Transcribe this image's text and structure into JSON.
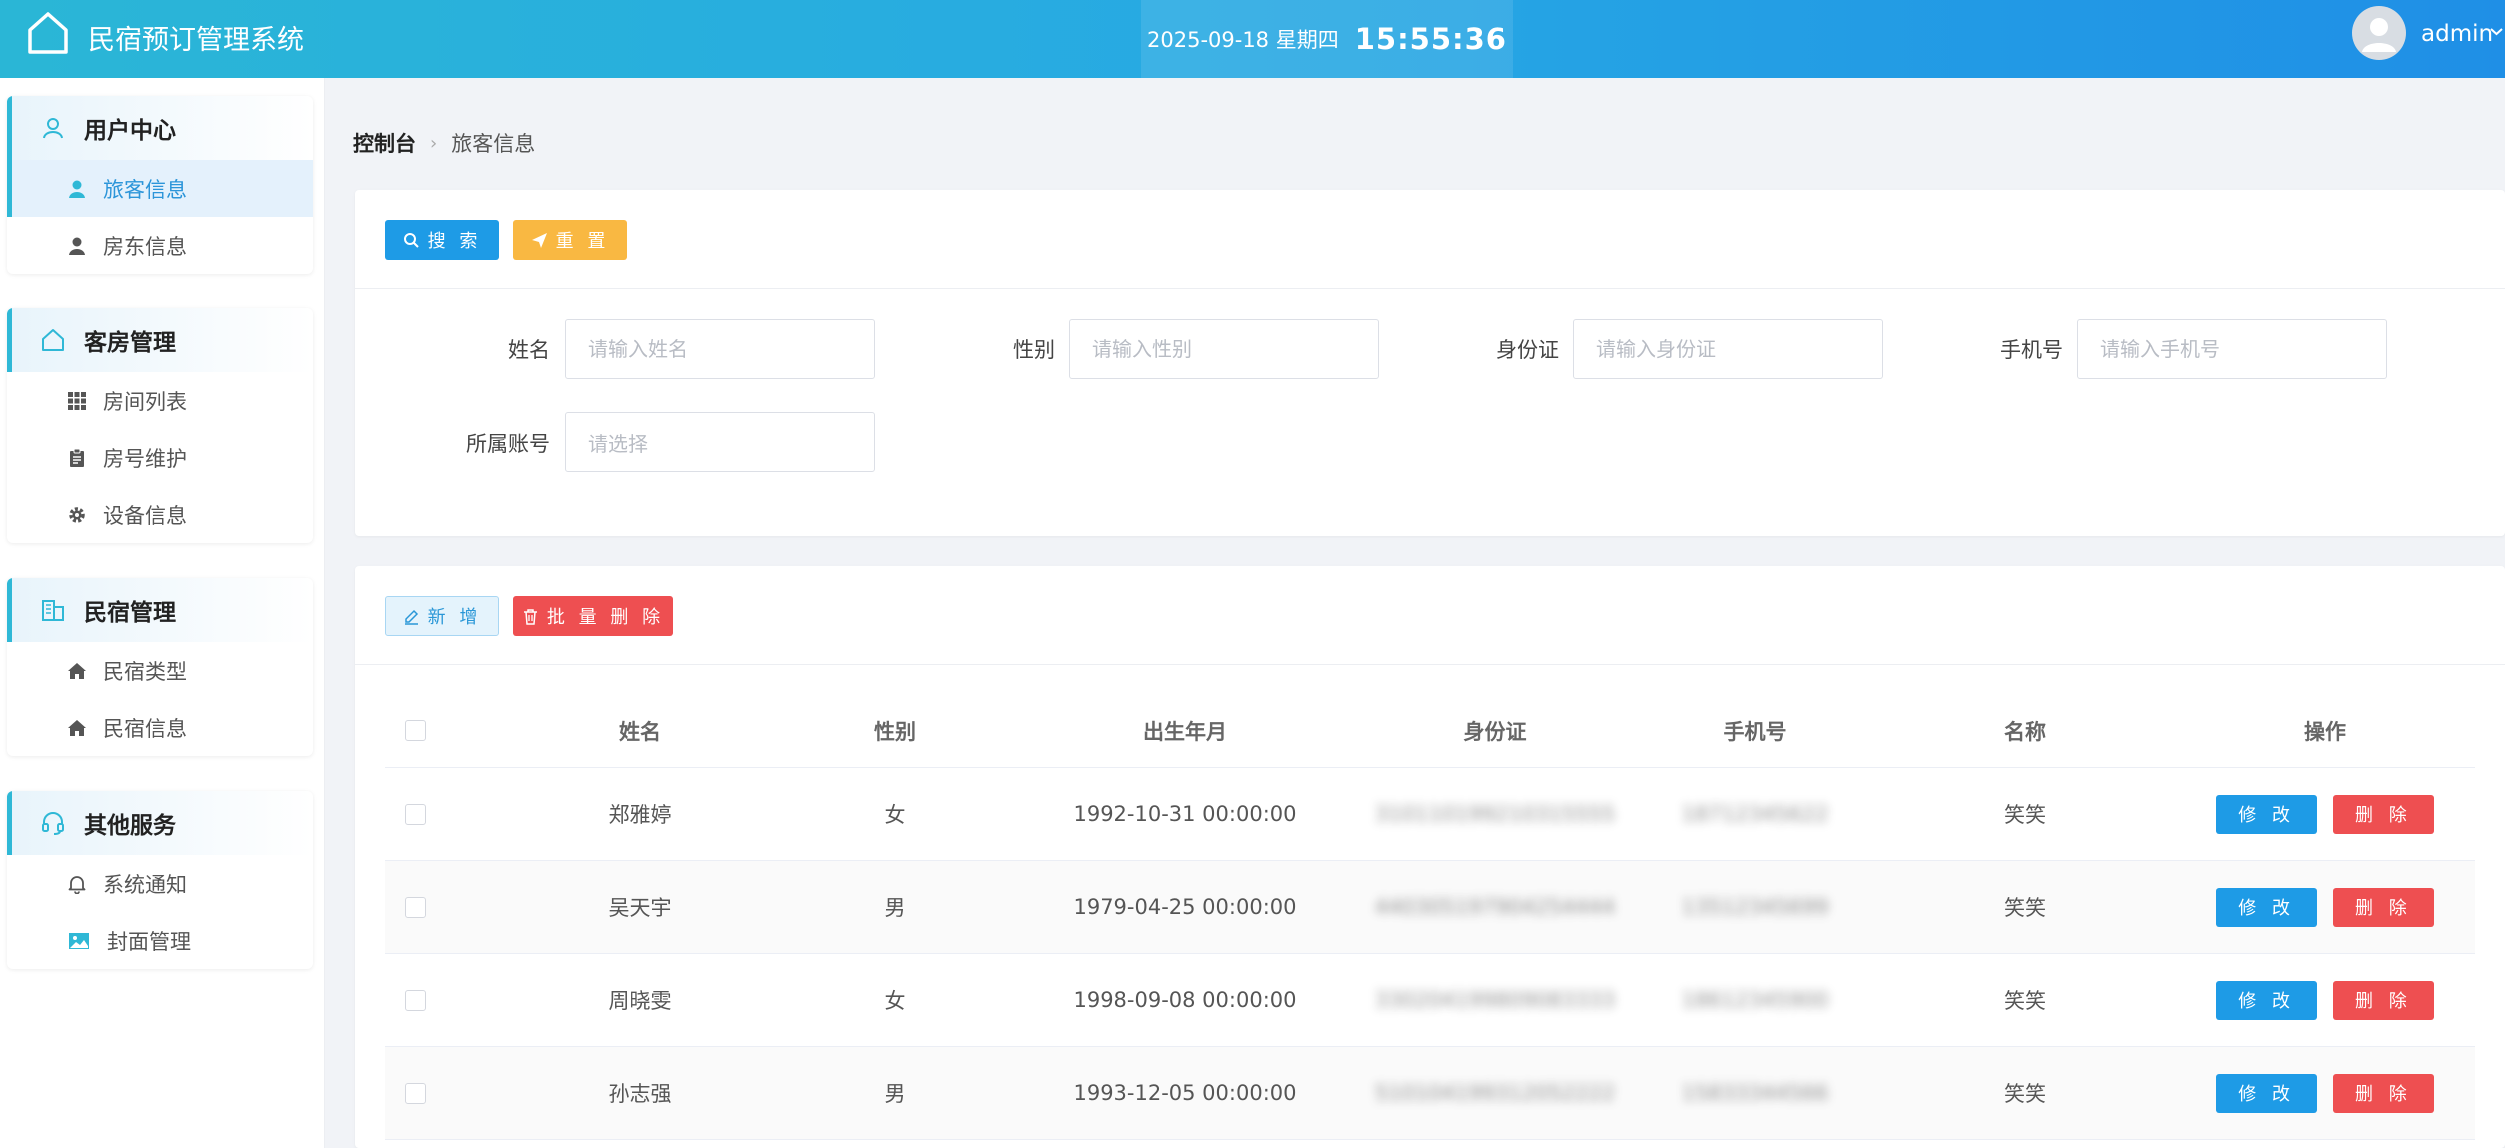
{
  "app": {
    "title": "民宿预订管理系统"
  },
  "clock": {
    "date": "2025-09-18 星期四",
    "time": "15:55:36"
  },
  "user": {
    "name": "admin"
  },
  "sidebar": {
    "groups": [
      {
        "title": "用户中心",
        "icon": "user-outline-icon",
        "items": [
          {
            "label": "旅客信息",
            "icon": "person-icon",
            "active": true
          },
          {
            "label": "房东信息",
            "icon": "person-icon"
          }
        ]
      },
      {
        "title": "客房管理",
        "icon": "home-outline-icon",
        "items": [
          {
            "label": "房间列表",
            "icon": "grid-icon"
          },
          {
            "label": "房号维护",
            "icon": "clipboard-icon"
          },
          {
            "label": "设备信息",
            "icon": "gear-icon"
          }
        ]
      },
      {
        "title": "民宿管理",
        "icon": "building-icon",
        "items": [
          {
            "label": "民宿类型",
            "icon": "house-icon"
          },
          {
            "label": "民宿信息",
            "icon": "house-icon"
          }
        ]
      },
      {
        "title": "其他服务",
        "icon": "headset-icon",
        "items": [
          {
            "label": "系统通知",
            "icon": "bell-icon"
          },
          {
            "label": "封面管理",
            "icon": "picture-icon"
          }
        ]
      }
    ]
  },
  "breadcrumb": {
    "root": "控制台",
    "current": "旅客信息"
  },
  "search": {
    "search_label": "搜 索",
    "reset_label": "重 置",
    "fields": {
      "name": {
        "label": "姓名",
        "placeholder": "请输入姓名"
      },
      "gender": {
        "label": "性别",
        "placeholder": "请输入性别"
      },
      "idcard": {
        "label": "身份证",
        "placeholder": "请输入身份证"
      },
      "phone": {
        "label": "手机号",
        "placeholder": "请输入手机号"
      },
      "account": {
        "label": "所属账号",
        "placeholder": "请选择"
      }
    }
  },
  "toolbar": {
    "add_label": "新 增",
    "batch_delete_label": "批 量 删 除"
  },
  "table": {
    "columns": {
      "name": "姓名",
      "gender": "性别",
      "birth": "出生年月",
      "idcard": "身份证",
      "phone": "手机号",
      "title": "名称",
      "ops": "操作"
    },
    "rows": [
      {
        "name": "郑雅婷",
        "gender": "女",
        "birth": "1992-10-31 00:00:00",
        "idcard": "310110199210315555",
        "phone": "18712345622",
        "title": "笑笑"
      },
      {
        "name": "吴天宇",
        "gender": "男",
        "birth": "1979-04-25 00:00:00",
        "idcard": "440305197904254444",
        "phone": "13512345699",
        "title": "笑笑"
      },
      {
        "name": "周晓雯",
        "gender": "女",
        "birth": "1998-09-08 00:00:00",
        "idcard": "330204199809083333",
        "phone": "18612345900",
        "title": "笑笑"
      },
      {
        "name": "孙志强",
        "gender": "男",
        "birth": "1993-12-05 00:00:00",
        "idcard": "510104199312052222",
        "phone": "15833344566",
        "title": "笑笑"
      }
    ],
    "edit_label": "修 改",
    "delete_label": "删 除"
  }
}
